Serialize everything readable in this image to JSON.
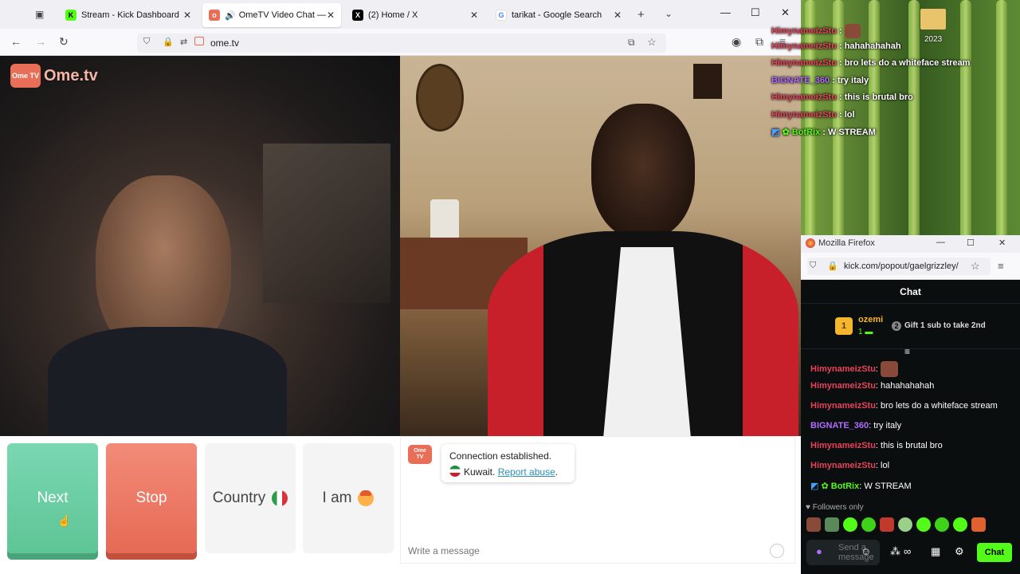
{
  "tabs": [
    {
      "label": "Stream - Kick Dashboard",
      "favicon": "kick-icon",
      "color": "#53fc18"
    },
    {
      "label": "OmeTV Video Chat — Om",
      "favicon": "ometv-icon",
      "color": "#e86e58",
      "active": true
    },
    {
      "label": "(2) Home / X",
      "favicon": "x-icon",
      "color": "#000000"
    },
    {
      "label": "tarikat - Google Search",
      "favicon": "google-icon",
      "color": "#4285f4"
    }
  ],
  "url": "ome.tv",
  "logo": {
    "badge": "Ome TV",
    "brand": "Ome.tv"
  },
  "buttons": {
    "next": "Next",
    "stop": "Stop",
    "country": "Country",
    "iam": "I am"
  },
  "connection": {
    "status": "Connection established.",
    "country": "Kuwait.",
    "report": "Report abuse",
    "suffix": "."
  },
  "message_placeholder": "Write a message",
  "overlay_chat": [
    {
      "user": "HimynameizStu",
      "text": ""
    },
    {
      "user": "HimynameizStu",
      "text": "hahahahahah"
    },
    {
      "user": "HimynameizStu",
      "text": "bro lets do a whiteface stream"
    },
    {
      "user": "BIGNATE_360",
      "text": "try italy",
      "color": "purple"
    },
    {
      "user": "HimynameizStu",
      "text": "this is brutal bro"
    },
    {
      "user": "HimynameizStu",
      "text": "lol"
    },
    {
      "user": "BotRix",
      "text": "W STREAM",
      "color": "green"
    }
  ],
  "desktop": {
    "folder_label": "2023"
  },
  "popout": {
    "title": "Mozilla Firefox",
    "url": "kick.com/popout/gaelgrizzley/",
    "header": "Chat",
    "gift_user": "ozemi",
    "gift_count": "1",
    "gift_rank": "1",
    "gift_text": "Gift 1 sub to take 2nd",
    "gift_badge": "2",
    "messages": [
      {
        "user": "HimynameizStu",
        "text": ""
      },
      {
        "user": "HimynameizStu",
        "text": "hahahahahah"
      },
      {
        "user": "HimynameizStu",
        "text": "bro lets do a whiteface stream"
      },
      {
        "user": "BIGNATE_360",
        "text": "try italy",
        "color": "purple"
      },
      {
        "user": "HimynameizStu",
        "text": "this is brutal bro"
      },
      {
        "user": "HimynameizStu",
        "text": "lol"
      },
      {
        "user": "BotRix",
        "text": "W STREAM",
        "color": "green"
      }
    ],
    "followers_only": "Followers only",
    "send_placeholder": "Send a message",
    "chat_button": "Chat"
  }
}
